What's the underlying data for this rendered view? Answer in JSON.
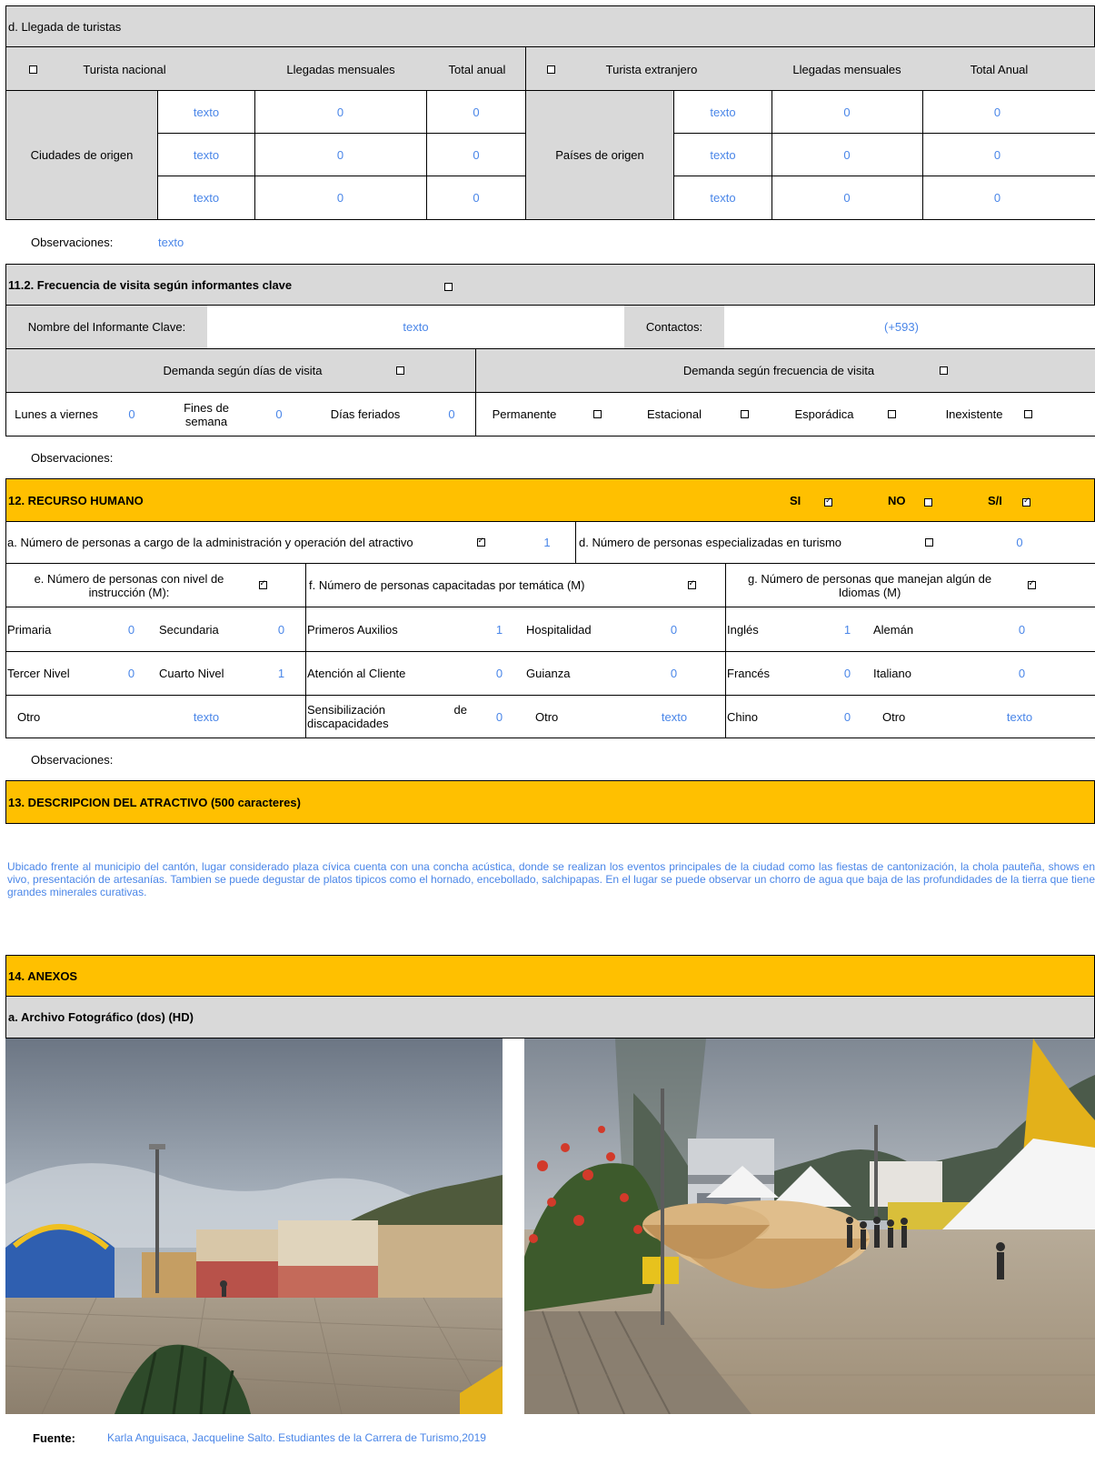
{
  "section_d": {
    "title": "d. Llegada de turistas",
    "nacional_label": "Turista nacional",
    "extranjero_label": "Turista extranjero",
    "llegadas_mensuales": "Llegadas mensuales",
    "total_anual": "Total anual",
    "total_anual_ext": "Total Anual",
    "ciudades_label": "Ciudades de origen",
    "paises_label": "Países de origen",
    "rows": [
      {
        "nac_text": "texto",
        "nac_month": "0",
        "nac_total": "0",
        "ext_text": "texto",
        "ext_month": "0",
        "ext_total": "0"
      },
      {
        "nac_text": "texto",
        "nac_month": "0",
        "nac_total": "0",
        "ext_text": "texto",
        "ext_month": "0",
        "ext_total": "0"
      },
      {
        "nac_text": "texto",
        "nac_month": "0",
        "nac_total": "0",
        "ext_text": "texto",
        "ext_month": "0",
        "ext_total": "0"
      }
    ],
    "observaciones_label": "Observaciones:",
    "observaciones_value": "texto"
  },
  "section_11_2": {
    "title": "11.2. Frecuencia de visita según informantes clave",
    "informante_label": "Nombre del Informante Clave:",
    "informante_value": "texto",
    "contactos_label": "Contactos:",
    "contactos_value": "(+593)",
    "demanda_dias": "Demanda según  días de visita",
    "demanda_frecuencia": "Demanda según frecuencia de visita",
    "lunes_label": "Lunes a viernes",
    "lunes_value": "0",
    "fines_label": "Fines de semana",
    "fines_value": "0",
    "feriados_label": "Días feriados",
    "feriados_value": "0",
    "permanente": "Permanente",
    "estacional": "Estacional",
    "esporadica": "Esporádica",
    "inexistente": "Inexistente",
    "observaciones_label": "Observaciones:"
  },
  "section_12": {
    "title": "12. RECURSO HUMANO",
    "si": "SI",
    "no": "NO",
    "si_no_info": "S/I",
    "a_label": "a. Número de personas a cargo de la administración y operación del atractivo",
    "a_value": "1",
    "d_label": "d. Número de personas especializadas en turismo",
    "d_value": "0",
    "e_label": "e. Número de personas con nivel de instrucción (M):",
    "f_label": "f. Número de personas capacitadas por temática (M)",
    "g_label": "g. Número de personas que manejan algún de Idiomas (M)",
    "primaria": "Primaria",
    "primaria_v": "0",
    "secundaria": "Secundaria",
    "secundaria_v": "0",
    "tercer": "Tercer Nivel",
    "tercer_v": "0",
    "cuarto": "Cuarto Nivel",
    "cuarto_v": "1",
    "otro_e": "Otro",
    "otro_e_v": "texto",
    "primeros": "Primeros Auxilios",
    "primeros_v": "1",
    "hospitalidad": "Hospitalidad",
    "hospitalidad_v": "0",
    "atencion": "Atención al Cliente",
    "atencion_v": "0",
    "guianza": "Guianza",
    "guianza_v": "0",
    "sensibilizacion": "Sensibilización de discapacidades",
    "sensibilizacion_v": "0",
    "otro_f": "Otro",
    "otro_f_v": "texto",
    "ingles": "Inglés",
    "ingles_v": "1",
    "aleman": "Alemán",
    "aleman_v": "0",
    "frances": "Francés",
    "frances_v": "0",
    "italiano": "Italiano",
    "italiano_v": "0",
    "chino": "Chino",
    "chino_v": "0",
    "otro_g": "Otro",
    "otro_g_v": "texto",
    "observaciones_label": "Observaciones:"
  },
  "section_13": {
    "title": "13. DESCRIPCION DEL ATRACTIVO (500 caracteres)",
    "text": "Ubicado frente al municipio del cantón, lugar considerado plaza cívica cuenta con una concha acústica, donde se realizan los eventos principales de la ciudad como las fiestas de cantonización, la chola pauteña, shows en vivo, presentación de artesanías. Tambien se puede degustar de platos tipicos como el hornado, encebollado, salchipapas. En el lugar se puede observar un chorro de agua que baja de las profundidades de la tierra que tiene grandes minerales curativas."
  },
  "section_14": {
    "title": "14. ANEXOS",
    "archivo": "a. Archivo Fotográfico (dos) (HD)",
    "fuente_label": "Fuente:",
    "fuente_value": "Karla Anguisaca, Jacqueline Salto. Estudiantes de la Carrera de Turismo,2019"
  }
}
